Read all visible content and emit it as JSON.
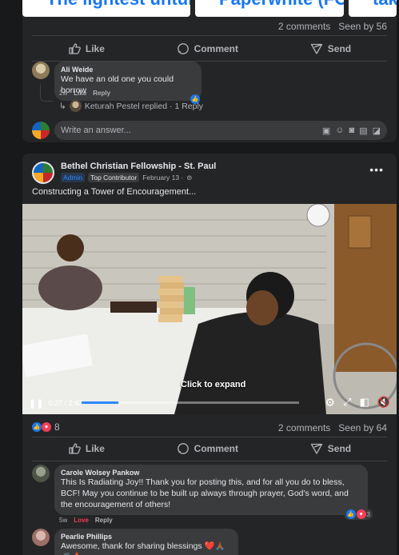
{
  "top_post": {
    "link_previews": [
      "The lightest untuk",
      "Paperwhite (FOM",
      "tak"
    ],
    "stats": {
      "comments": "2 comments",
      "seen": "Seen by 56"
    },
    "actions": {
      "like": "Like",
      "comment": "Comment",
      "send": "Send"
    },
    "comment": {
      "author": "Ali Weide",
      "text": "We have an old one you could borrow",
      "time": "2w",
      "like": "Like",
      "reply": "Reply"
    },
    "reply_summary": "Keturah Pestel replied · 1 Reply",
    "write_placeholder": "Write an answer..."
  },
  "post": {
    "group_name": "Bethel Christian Fellowship - St. Paul",
    "badge_admin": "Admin",
    "badge_contributor": "Top Contributor",
    "date": "February 13 ·",
    "more": "•••",
    "text": "Constructing a Tower of Encouragement...",
    "video": {
      "expand_label": "Click to expand",
      "time": "0:27 / 2:42",
      "progress": 0.17
    },
    "reaction_count": "8",
    "stats": {
      "comments": "2 comments",
      "seen": "Seen by 64"
    },
    "actions": {
      "like": "Like",
      "comment": "Comment",
      "send": "Send"
    },
    "comments": [
      {
        "author": "Carole Wolsey Pankow",
        "text": "This Is Radiating Joy!! Thank you for posting this, and for all you do to bless, BCF! May you continue to be built up always through prayer, God's word, and the encouragement of others!",
        "time": "5w",
        "love": "Love",
        "reply": "Reply",
        "reaction_count": "3"
      },
      {
        "author": "Pearlie Phillips",
        "text": "Awesome, thank for sharing blessings ❤️🙏🏾🎵🔥"
      }
    ]
  },
  "colors": {
    "accent": "#2d88ff",
    "love": "#f33e58",
    "card": "#242526",
    "bubble": "#3a3b3c"
  }
}
